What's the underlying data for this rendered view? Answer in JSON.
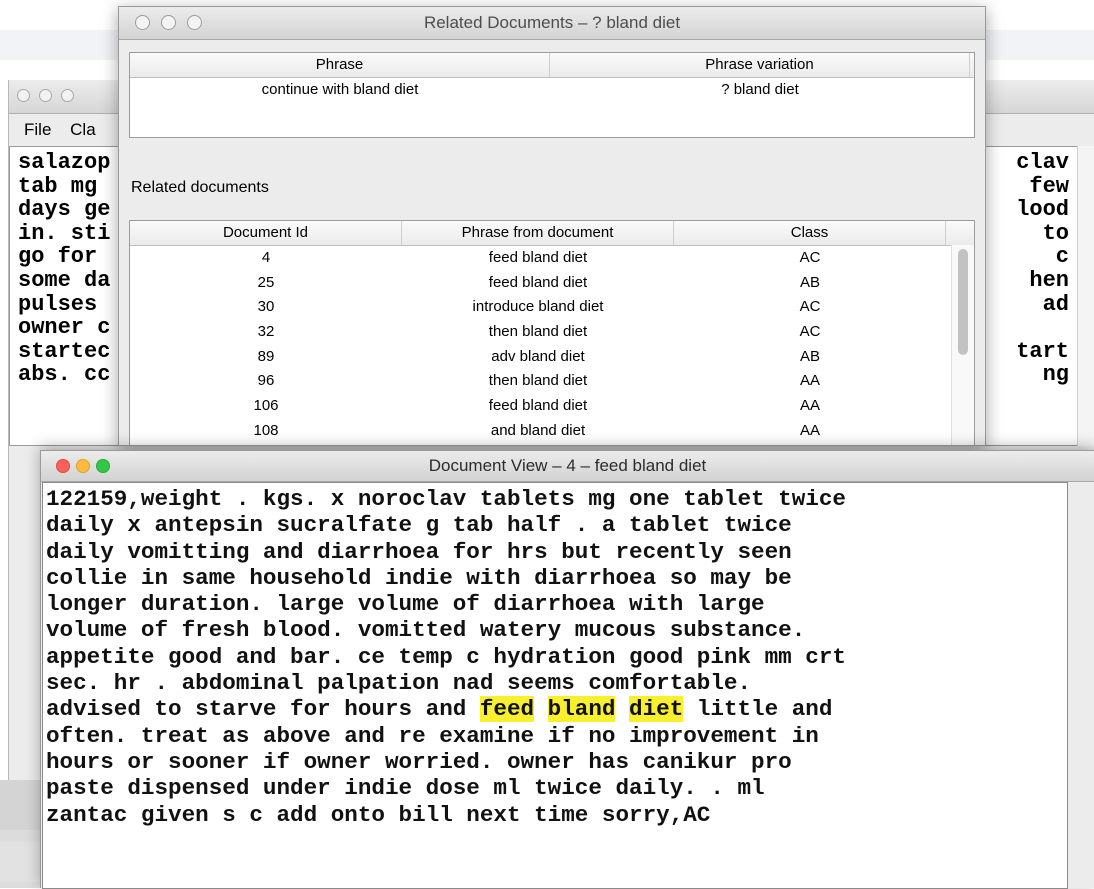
{
  "main_window": {
    "menu": [
      "File",
      "Cla"
    ],
    "text_left": [
      "salazop",
      "tab mg",
      "days ge",
      "in. sti",
      "go for",
      "some da",
      "pulses",
      "owner c",
      "startec",
      "abs. cc"
    ],
    "text_right": [
      "clav",
      "few",
      "lood",
      "to",
      "c",
      "hen",
      "ad",
      "",
      "tart",
      "ng"
    ]
  },
  "related_window": {
    "title": "Related Documents – ? bland diet",
    "phrase_table": {
      "headers": [
        "Phrase",
        "Phrase variation"
      ],
      "rows": [
        {
          "phrase": "continue with bland diet",
          "variation": "? bland diet"
        }
      ]
    },
    "related_label": "Related documents",
    "docs_table": {
      "headers": [
        "Document Id",
        "Phrase from document",
        "Class"
      ],
      "rows": [
        {
          "id": "4",
          "phrase": "feed bland diet",
          "class": "AC"
        },
        {
          "id": "25",
          "phrase": "feed bland diet",
          "class": "AB"
        },
        {
          "id": "30",
          "phrase": "introduce bland diet",
          "class": "AC"
        },
        {
          "id": "32",
          "phrase": "then bland diet",
          "class": "AC"
        },
        {
          "id": "89",
          "phrase": "adv bland diet",
          "class": "AB"
        },
        {
          "id": "96",
          "phrase": "then bland diet",
          "class": "AA"
        },
        {
          "id": "106",
          "phrase": "feed bland diet",
          "class": "AA"
        },
        {
          "id": "108",
          "phrase": "and bland diet",
          "class": "AA"
        }
      ]
    }
  },
  "doc_window": {
    "title": "Document View – 4 – feed bland diet",
    "lines": [
      "122159,weight . kgs. x noroclav tablets mg one tablet twice",
      "daily x antepsin sucralfate g tab half . a tablet twice",
      "daily vomitting and diarrhoea for hrs but recently seen",
      "collie in same household indie with diarrhoea so may be",
      "longer duration. large volume of diarrhoea with large",
      "volume of fresh blood. vomitted watery mucous substance.",
      "appetite good and bar. ce temp c hydration good pink mm crt",
      "sec. hr . abdominal palpation nad seems comfortable."
    ],
    "highlight_line": {
      "before": "advised to starve for hours and ",
      "words": [
        "feed",
        "bland",
        "diet"
      ],
      "after": " little and"
    },
    "lines_after": [
      "often. treat as above and re examine if no improvement in",
      "hours or sooner if owner worried. owner has canikur pro",
      "paste dispensed under indie dose ml twice daily. . ml",
      "zantac given s c add onto bill next time sorry,AC"
    ],
    "highlight_color": "#f8ef2f"
  }
}
